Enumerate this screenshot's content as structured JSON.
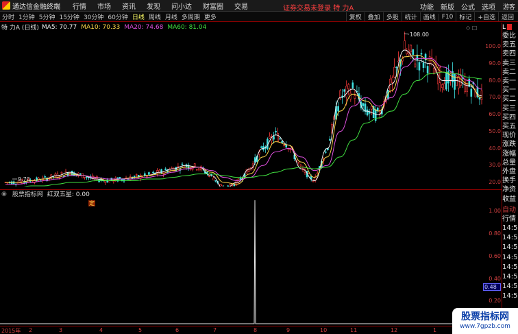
{
  "app": {
    "title": "通达信金融终端"
  },
  "menu": [
    "行情",
    "市场",
    "资讯",
    "发现",
    "问小达",
    "财富圈",
    "交易"
  ],
  "notice": "证券交易未登录",
  "notice_stock": "特 力A",
  "right_menu": [
    "功能",
    "新版",
    "公式",
    "选项"
  ],
  "guest": "游客",
  "periods": [
    "分时",
    "1分钟",
    "5分钟",
    "15分钟",
    "30分钟",
    "60分钟",
    "日线",
    "周线",
    "月线",
    "多周期",
    "更多"
  ],
  "active_period": "日线",
  "tools": [
    "复权",
    "叠加",
    "多股",
    "统计",
    "画线",
    "F10",
    "标记",
    "+自选",
    "返回"
  ],
  "stock_info": {
    "label": "特 力A (日线)",
    "ma5": "MA5: 70.77",
    "ma10": "MA10: 70.33",
    "ma20": "MA20: 74.68",
    "ma60": "MA60: 81.04"
  },
  "price_axis": [
    "100.0",
    "90.0",
    "80.0",
    "70.0",
    "60.0",
    "50.0",
    "40.0",
    "30.0",
    "20.0"
  ],
  "high_label": "108.00",
  "low_label": "9.70",
  "marker_label": "定",
  "indicator": {
    "name": "股票指标网",
    "title": "红双五星:",
    "value": "0.00"
  },
  "ind_axis": [
    "1.00",
    "0.80",
    "0.60",
    "0.40",
    "0.20"
  ],
  "cursor_value": "0.48",
  "x_axis": [
    "2015年",
    "2",
    "3",
    "4",
    "5",
    "6",
    "7",
    "8",
    "9",
    "10",
    "11",
    "12",
    "1"
  ],
  "right_panel": {
    "top": "L",
    "labels": [
      "委比",
      "卖五",
      "卖四",
      "卖三",
      "卖二",
      "卖一",
      "买一",
      "买二",
      "买三",
      "买四",
      "买五",
      "现价",
      "涨跌",
      "涨幅",
      "总量",
      "外盘",
      "换手",
      "净资",
      "收益"
    ],
    "auto": "自动",
    "auto2": "行情",
    "times": [
      "14:5",
      "14:5",
      "14:5",
      "14:5",
      "14:5",
      "14:5",
      "14:5",
      "14:5"
    ]
  },
  "watermark": {
    "title": "股票指标网",
    "url": "www.7gpzb.com"
  },
  "colors": {
    "up": "#ff3b3b",
    "down": "#40e0e0",
    "ma5": "#f0f0f0",
    "ma10": "#ffd84a",
    "ma20": "#e050e0",
    "ma60": "#40e040"
  },
  "chart_data": [
    {
      "type": "candlestick",
      "ylim": [
        10,
        108
      ],
      "series": [
        {
          "name": "MA5",
          "values": [
            20,
            20,
            21,
            22,
            24,
            26,
            24,
            22,
            21,
            22,
            23,
            24,
            26,
            28,
            30,
            29,
            24,
            16,
            20,
            28,
            40,
            48,
            42,
            28,
            21,
            40,
            70,
            75,
            62,
            60,
            78,
            98,
            92,
            90,
            80,
            80,
            77,
            71
          ]
        },
        {
          "name": "MA10",
          "values": [
            20,
            20,
            21,
            22,
            23,
            25,
            24,
            23,
            21,
            22,
            23,
            24,
            25,
            27,
            29,
            29,
            26,
            20,
            19,
            25,
            35,
            44,
            42,
            32,
            23,
            35,
            62,
            72,
            68,
            62,
            74,
            94,
            95,
            92,
            85,
            82,
            78,
            70
          ]
        },
        {
          "name": "MA20",
          "values": [
            19,
            19,
            20,
            21,
            22,
            24,
            24,
            23,
            22,
            22,
            22,
            23,
            24,
            26,
            28,
            29,
            27,
            23,
            21,
            23,
            30,
            38,
            40,
            35,
            27,
            30,
            50,
            65,
            70,
            65,
            70,
            88,
            93,
            93,
            88,
            84,
            80,
            75
          ]
        },
        {
          "name": "MA60",
          "values": [
            17,
            17,
            18,
            18,
            19,
            20,
            20,
            21,
            21,
            21,
            21,
            22,
            22,
            23,
            24,
            25,
            25,
            24,
            23,
            23,
            24,
            26,
            28,
            29,
            28,
            29,
            35,
            45,
            55,
            58,
            62,
            72,
            80,
            84,
            85,
            84,
            82,
            81
          ]
        }
      ]
    },
    {
      "type": "line",
      "title": "红双五星",
      "ylim": [
        0,
        1.1
      ],
      "spike_x": "8",
      "spike_value": 1.1
    }
  ]
}
